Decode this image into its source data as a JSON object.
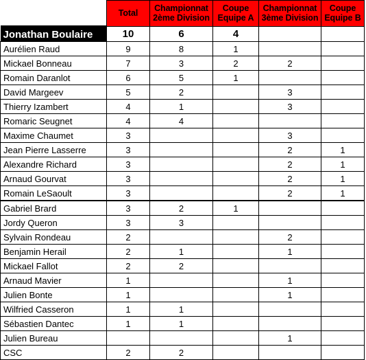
{
  "table": {
    "columns": [
      {
        "key": "name",
        "label": "",
        "lines": []
      },
      {
        "key": "total",
        "label": "Total",
        "lines": [
          "Total"
        ]
      },
      {
        "key": "ch2",
        "label": "Championnat 2ème Division",
        "lines": [
          "Championnat",
          "2ème Division"
        ]
      },
      {
        "key": "cupA",
        "label": "Coupe Equipe A",
        "lines": [
          "Coupe",
          "Equipe A"
        ]
      },
      {
        "key": "ch3",
        "label": "Championnat 3ème Division",
        "lines": [
          "Championnat",
          "3ème Division"
        ]
      },
      {
        "key": "cupB",
        "label": "Coupe Equipe B",
        "lines": [
          "Coupe",
          "Equipe B"
        ]
      }
    ],
    "header_bg": "#FF0000",
    "header_fg": "#000000",
    "highlight_bg": "#000000",
    "highlight_fg": "#FFFFFF",
    "rows": [
      {
        "name": "Jonathan Boulaire",
        "total": "10",
        "ch2": "6",
        "cupA": "4",
        "ch3": "",
        "cupB": "",
        "highlight": true,
        "separator": false
      },
      {
        "name": "Aurélien Raud",
        "total": "9",
        "ch2": "8",
        "cupA": "1",
        "ch3": "",
        "cupB": "",
        "highlight": false,
        "separator": false
      },
      {
        "name": "Mickael Bonneau",
        "total": "7",
        "ch2": "3",
        "cupA": "2",
        "ch3": "2",
        "cupB": "",
        "highlight": false,
        "separator": false
      },
      {
        "name": "Romain Daranlot",
        "total": "6",
        "ch2": "5",
        "cupA": "1",
        "ch3": "",
        "cupB": "",
        "highlight": false,
        "separator": false
      },
      {
        "name": "David Margeev",
        "total": "5",
        "ch2": "2",
        "cupA": "",
        "ch3": "3",
        "cupB": "",
        "highlight": false,
        "separator": false
      },
      {
        "name": "Thierry Izambert",
        "total": "4",
        "ch2": "1",
        "cupA": "",
        "ch3": "3",
        "cupB": "",
        "highlight": false,
        "separator": false
      },
      {
        "name": "Romaric Seugnet",
        "total": "4",
        "ch2": "4",
        "cupA": "",
        "ch3": "",
        "cupB": "",
        "highlight": false,
        "separator": false
      },
      {
        "name": "Maxime Chaumet",
        "total": "3",
        "ch2": "",
        "cupA": "",
        "ch3": "3",
        "cupB": "",
        "highlight": false,
        "separator": false
      },
      {
        "name": "Jean Pierre Lasserre",
        "total": "3",
        "ch2": "",
        "cupA": "",
        "ch3": "2",
        "cupB": "1",
        "highlight": false,
        "separator": false
      },
      {
        "name": "Alexandre Richard",
        "total": "3",
        "ch2": "",
        "cupA": "",
        "ch3": "2",
        "cupB": "1",
        "highlight": false,
        "separator": false
      },
      {
        "name": "Arnaud Gourvat",
        "total": "3",
        "ch2": "",
        "cupA": "",
        "ch3": "2",
        "cupB": "1",
        "highlight": false,
        "separator": false
      },
      {
        "name": "Romain LeSaoult",
        "total": "3",
        "ch2": "",
        "cupA": "",
        "ch3": "2",
        "cupB": "1",
        "highlight": false,
        "separator": false
      },
      {
        "name": "Gabriel Brard",
        "total": "3",
        "ch2": "2",
        "cupA": "1",
        "ch3": "",
        "cupB": "",
        "highlight": false,
        "separator": true
      },
      {
        "name": "Jordy Queron",
        "total": "3",
        "ch2": "3",
        "cupA": "",
        "ch3": "",
        "cupB": "",
        "highlight": false,
        "separator": false
      },
      {
        "name": "Sylvain Rondeau",
        "total": "2",
        "ch2": "",
        "cupA": "",
        "ch3": "2",
        "cupB": "",
        "highlight": false,
        "separator": false
      },
      {
        "name": "Benjamin Herail",
        "total": "2",
        "ch2": "1",
        "cupA": "",
        "ch3": "1",
        "cupB": "",
        "highlight": false,
        "separator": false
      },
      {
        "name": "Mickael Fallot",
        "total": "2",
        "ch2": "2",
        "cupA": "",
        "ch3": "",
        "cupB": "",
        "highlight": false,
        "separator": false
      },
      {
        "name": "Arnaud Mavier",
        "total": "1",
        "ch2": "",
        "cupA": "",
        "ch3": "1",
        "cupB": "",
        "highlight": false,
        "separator": false
      },
      {
        "name": "Julien Bonte",
        "total": "1",
        "ch2": "",
        "cupA": "",
        "ch3": "1",
        "cupB": "",
        "highlight": false,
        "separator": false
      },
      {
        "name": "Wilfried Casseron",
        "total": "1",
        "ch2": "1",
        "cupA": "",
        "ch3": "",
        "cupB": "",
        "highlight": false,
        "separator": false
      },
      {
        "name": "Sébastien Dantec",
        "total": "1",
        "ch2": "1",
        "cupA": "",
        "ch3": "",
        "cupB": "",
        "highlight": false,
        "separator": false
      },
      {
        "name": "Julien Bureau",
        "total": "",
        "ch2": "",
        "cupA": "",
        "ch3": "1",
        "cupB": "",
        "highlight": false,
        "separator": false
      },
      {
        "name": "CSC",
        "total": "2",
        "ch2": "2",
        "cupA": "",
        "ch3": "",
        "cupB": "",
        "highlight": false,
        "separator": false
      }
    ]
  }
}
